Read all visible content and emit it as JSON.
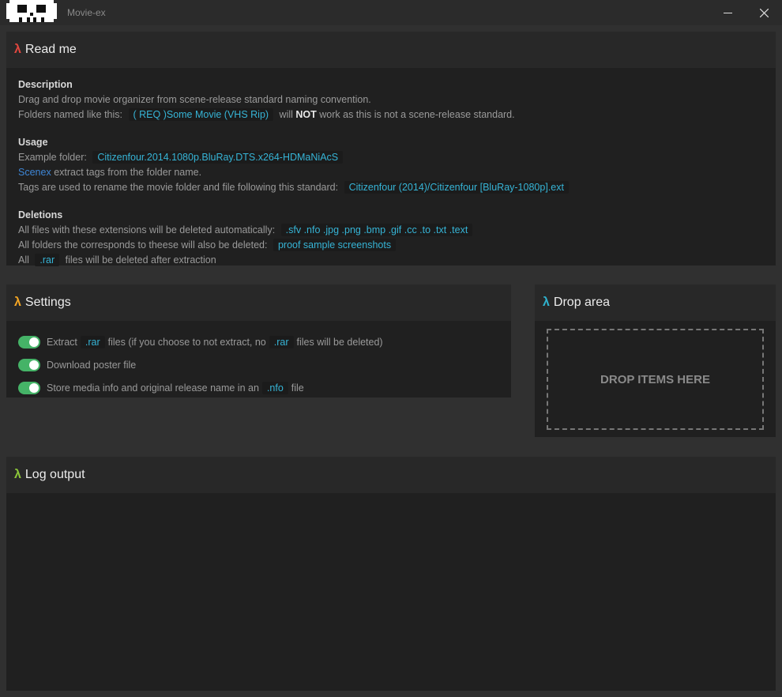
{
  "window": {
    "title": "Movie-ex",
    "minimize_icon": "minimize-icon",
    "close_icon": "close-icon",
    "logo_icon": "pixel-skull-icon"
  },
  "colors": {
    "lambda_readme": "#e2473f",
    "lambda_settings": "#f5a623",
    "lambda_drop": "#2fb3cf",
    "lambda_log": "#8cc739",
    "code_text": "#36b4d6",
    "link": "#3e86d6",
    "toggle_on": "#45b367"
  },
  "lambda": "λ",
  "readme": {
    "title": "Read me",
    "description": {
      "heading": "Description",
      "line1": "Drag and drop movie organizer from scene-release standard naming convention.",
      "line2_pre": "Folders named like this:",
      "line2_code": "( REQ )Some Movie (VHS Rip)",
      "line2_mid": "will",
      "line2_bold": "NOT",
      "line2_post": "work as this is not a scene-release standard."
    },
    "usage": {
      "heading": "Usage",
      "line1_pre": "Example folder:",
      "line1_code": "Citizenfour.2014.1080p.BluRay.DTS.x264-HDMaNiAcS",
      "line2_link": "Scenex",
      "line2_post": "extract tags from the folder name.",
      "line3_pre": "Tags are used to rename the movie folder and file following this standard:",
      "line3_code": "Citizenfour (2014)/Citizenfour [BluRay-1080p].ext"
    },
    "deletions": {
      "heading": "Deletions",
      "line1_pre": "All files with these extensions will be deleted automatically:",
      "line1_code": ".sfv .nfo .jpg .png .bmp .gif .cc .to .txt .text",
      "line2_pre": "All folders the corresponds to theese will also be deleted:",
      "line2_code": "proof sample screenshots",
      "line3_pre": "All",
      "line3_code": ".rar",
      "line3_post": "files will be deleted after extraction"
    }
  },
  "settings": {
    "title": "Settings",
    "items": [
      {
        "pre": "Extract",
        "code1": ".rar",
        "mid": "files (if you choose to not extract, no",
        "code2": ".rar",
        "post": "files will be deleted)",
        "on": true
      },
      {
        "pre": "Download poster file",
        "on": true
      },
      {
        "pre": "Store media info and original release name in an",
        "code1": ".nfo",
        "post": "file",
        "on": true
      }
    ]
  },
  "drop": {
    "title": "Drop area",
    "label": "DROP ITEMS HERE"
  },
  "log": {
    "title": "Log output"
  }
}
